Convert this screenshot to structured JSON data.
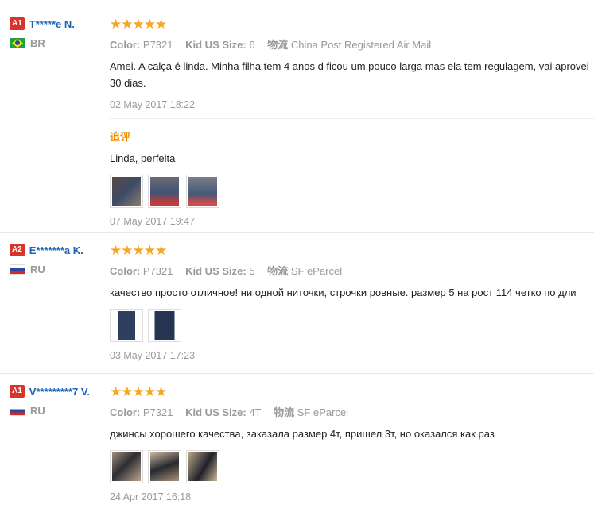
{
  "reviews": [
    {
      "badge": "A1",
      "name": "T*****e N.",
      "country": "BR",
      "stars": "★★★★★",
      "color_label": "Color:",
      "color_value": "P7321",
      "size_label": "Kid US Size:",
      "size_value": "6",
      "ship_label": "物流",
      "ship_value": "China Post Registered Air Mail",
      "text": "Amei. A calça é linda. Minha filha tem 4 anos d ficou um pouco larga mas ela tem regulagem, vai aprovei",
      "text2": "30 dias.",
      "date": "02 May 2017 18:22",
      "followup": {
        "title": "追评",
        "text": "Linda, perfeita",
        "date": "07 May 2017 19:47"
      }
    },
    {
      "badge": "A2",
      "name": "E*******a K.",
      "country": "RU",
      "stars": "★★★★★",
      "color_label": "Color:",
      "color_value": "P7321",
      "size_label": "Kid US Size:",
      "size_value": "5",
      "ship_label": "物流",
      "ship_value": "SF eParcel",
      "text": "качество просто отличное! ни одной ниточки, строчки ровные. размер 5 на рост 114 четко по дли",
      "date": "03 May 2017 17:23"
    },
    {
      "badge": "A1",
      "name": "V*********7 V.",
      "country": "RU",
      "stars": "★★★★★",
      "color_label": "Color:",
      "color_value": "P7321",
      "size_label": "Kid US Size:",
      "size_value": "4T",
      "ship_label": "物流",
      "ship_value": "SF eParcel",
      "text": "джинсы хорошего качества, заказала размер 4т, пришел 3т, но оказался как раз",
      "date": "24 Apr 2017 16:18"
    }
  ]
}
